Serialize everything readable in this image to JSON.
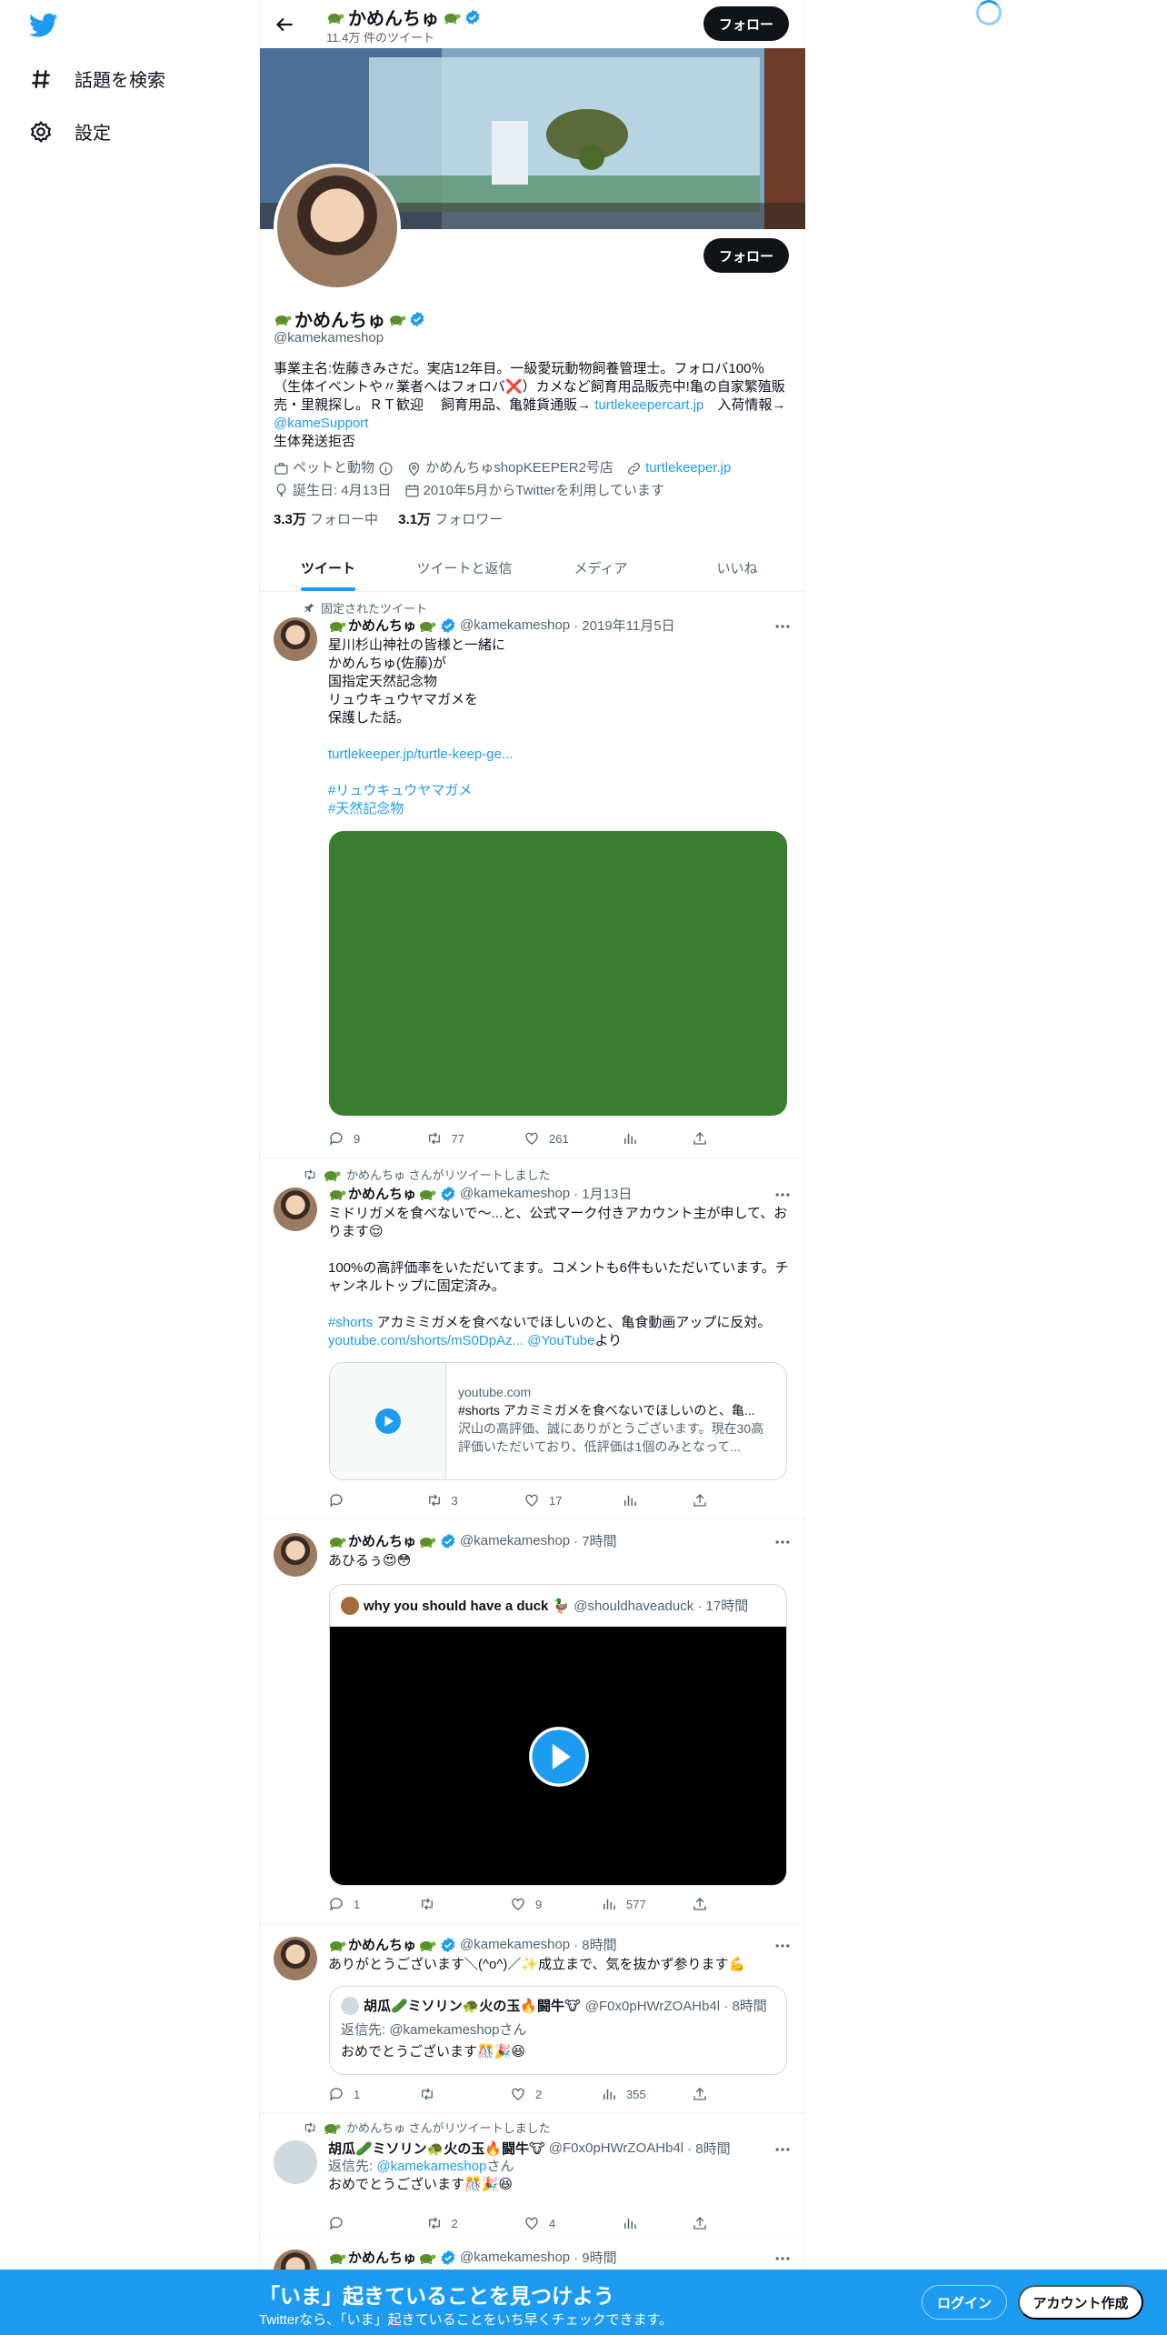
{
  "nav": {
    "explore": "話題を検索",
    "settings": "設定"
  },
  "header": {
    "name": "かめんちゅ",
    "tweet_count": "11.4万 件のツイート",
    "follow": "フォロー"
  },
  "profile": {
    "name": "かめんちゅ",
    "handle": "@kamekameshop",
    "follow": "フォロー",
    "bio_1": "事業主名:佐藤きみさだ。実店12年目。一級愛玩動物飼養管理士。フォロバ100％（生体イベントや〃業者へはフォロバ❌）カメなど飼育用品販売中!亀の自家繁殖販売・里親探し。ＲＴ歓迎　 飼育用品、亀雑貨通販→ ",
    "bio_link": "turtlekeepercart.jp",
    "bio_2": "　入荷情報→ ",
    "bio_mention": "@kameSupport",
    "bio_3": "生体発送拒否",
    "category": "ペットと動物",
    "location": "かめんちゅshopKEEPER2号店",
    "url": "turtlekeeper.jp",
    "birthday": "誕生日: 4月13日",
    "joined": "2010年5月からTwitterを利用しています",
    "following_count": "3.3万",
    "following_label": " フォロー中",
    "followers_count": "3.1万",
    "followers_label": " フォロワー"
  },
  "tabs": [
    "ツイート",
    "ツイートと返信",
    "メディア",
    "いいね"
  ],
  "tweets": [
    {
      "pinned": "固定されたツイート",
      "name": "かめんちゅ",
      "handle": "@kamekameshop",
      "date": "· 2019年11月5日",
      "text": "星川杉山神社の皆様と一緒に\nかめんちゅ(佐藤)が\n国指定天然記念物\nリュウキュウヤマガメを\n保護した話。",
      "link": "turtlekeeper.jp/turtle-keep-ge...",
      "tag1": "#リュウキュウヤマガメ",
      "tag2": "#天然記念物",
      "replies": "9",
      "retweets": "77",
      "likes": "261"
    },
    {
      "social": "かめんちゅ さんがリツイートしました",
      "name": "かめんちゅ",
      "handle": "@kamekameshop",
      "date": "· 1月13日",
      "text": "ミドリガメを食べないで～...と、公式マーク付きアカウント主が申して、おります😌\n\n100%の高評価率をいただいてます。コメントも6件もいただいています。チャンネルトップに固定済み。",
      "tag": "#shorts",
      "text2": " アカミミガメを食べないでほしいのと、亀食動画アップに反対。",
      "link": "youtube.com/shorts/mS0DpAz...",
      "mention": " @YouTube",
      "text3": "より",
      "card_domain": "youtube.com",
      "card_title": "#shorts アカミミガメを食べないでほしいのと、亀...",
      "card_desc": "沢山の高評価、誠にありがとうございます。現在30高評価いただいており、低評価は1個のみとなって...",
      "replies": "",
      "retweets": "3",
      "likes": "17"
    },
    {
      "name": "かめんちゅ",
      "handle": "@kamekameshop",
      "date": "· 7時間",
      "text": "あひるぅ😍😳",
      "quote_name": "why you should have a duck 🦆",
      "quote_handle": "@shouldhaveaduck · 17時間",
      "replies": "1",
      "retweets": "",
      "likes": "9",
      "views": "577"
    },
    {
      "name": "かめんちゅ",
      "handle": "@kamekameshop",
      "date": "· 8時間",
      "text": "ありがとうございます＼(^o^)／✨成立まで、気を抜かず参ります💪",
      "quote_name": "胡瓜🥒ミソリン🐢火の玉🔥闘牛🐮",
      "quote_handle": "@F0x0pHWrZOAHb4l · 8時間",
      "quote_reply": "返信先: @kamekameshopさん",
      "quote_text": "おめでとうございます🎊🎉😆",
      "replies": "1",
      "retweets": "",
      "likes": "2",
      "views": "355"
    },
    {
      "social": "かめんちゅ さんがリツイートしました",
      "name": "胡瓜🥒ミソリン🐢火の玉🔥闘牛🐮",
      "handle": "@F0x0pHWrZOAHb4l",
      "date": "· 8時間",
      "reply_to": "返信先: ",
      "reply_mention": "@kamekameshop",
      "reply_suffix": "さん",
      "text": "おめでとうございます🎊🎉😆",
      "replies": "",
      "retweets": "2",
      "likes": "4"
    },
    {
      "name": "かめんちゅ",
      "handle": "@kamekameshop",
      "date": "· 9時間"
    }
  ],
  "bottom": {
    "title": "「いま」起きていることを見つけよう",
    "subtitle": "Twitterなら、「いま」起きていることをいち早くチェックできます。",
    "login": "ログイン",
    "signup": "アカウント作成"
  }
}
